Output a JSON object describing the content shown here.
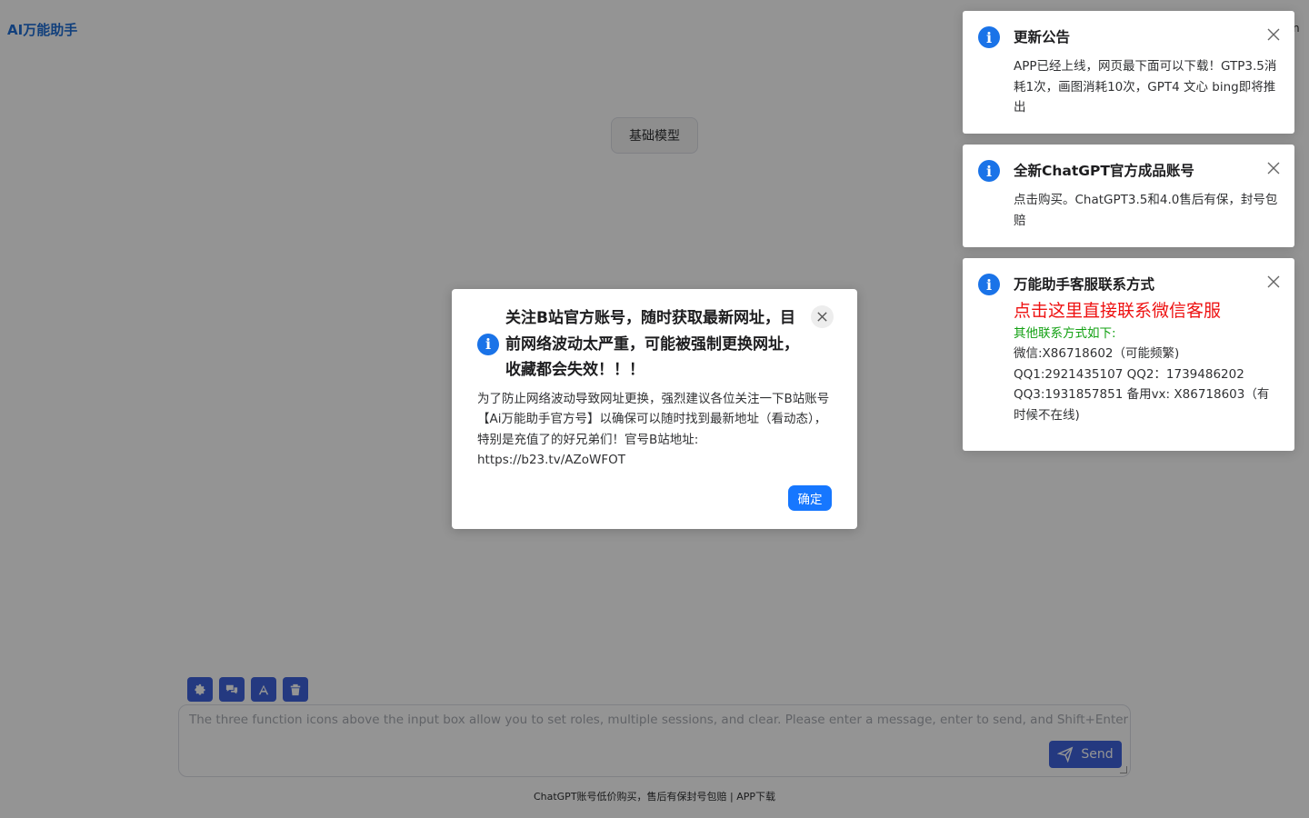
{
  "app": {
    "title": "AI万能助手",
    "corner_text": "n"
  },
  "main": {
    "model_button": "基础模型"
  },
  "toolbar": {
    "icons": [
      "gear-icon",
      "chat-bubbles-icon",
      "role-icon",
      "trash-icon"
    ]
  },
  "input": {
    "placeholder": "The three function icons above the input box allow you to set roles, multiple sessions, and clear. Please enter a message, enter to send, and Shift+Enter to wrap",
    "send_label": "Send"
  },
  "footer": {
    "text": "ChatGPT账号低价购买，售后有保封号包赔 | APP下载"
  },
  "dialog": {
    "title": "关注B站官方账号，随时获取最新网址，目前网络波动太严重，可能被强制更换网址，收藏都会失效！！！",
    "body": "为了防止网络波动导致网址更换，强烈建议各位关注一下B站账号【Ai万能助手官方号】以确保可以随时找到最新地址（看动态），特别是充值了的好兄弟们！官号B站地址: https://b23.tv/AZoWFOT",
    "confirm_label": "确定"
  },
  "notifications": [
    {
      "title": "更新公告",
      "body": "APP已经上线，网页最下面可以下载！GTP3.5消耗1次，画图消耗10次，GPT4 文心 bing即将推出"
    },
    {
      "title": "全新ChatGPT官方成品账号",
      "body": "点击购买。ChatGPT3.5和4.0售后有保，封号包赔"
    },
    {
      "title": "万能助手客服联系方式",
      "link": "点击这里直接联系微信客服",
      "sub": "其他联系方式如下:",
      "lines": [
        "微信:X86718602（可能频繁)",
        "QQ1:2921435107 QQ2：1739486202",
        "QQ3:1931857851 备用vx: X86718603（有时候不在线)"
      ]
    }
  ],
  "colors": {
    "accent": "#1677ff",
    "tool": "#3e63dd",
    "link_red": "#ee1111",
    "green": "#12a012"
  }
}
